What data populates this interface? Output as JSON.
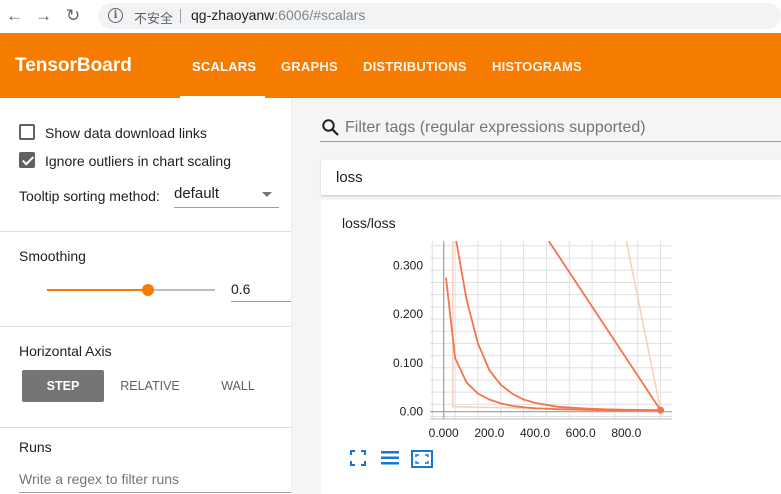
{
  "browser": {
    "back_icon": "back-arrow-icon",
    "forward_icon": "forward-arrow-icon",
    "reload_icon": "reload-icon",
    "info_glyph": "i",
    "insecure_label": "不安全",
    "url_host": "qg-zhaoyanw",
    "url_rest": ":6006/#scalars"
  },
  "header": {
    "brand": "TensorBoard",
    "tabs": [
      {
        "label": "SCALARS",
        "active": true
      },
      {
        "label": "GRAPHS"
      },
      {
        "label": "DISTRIBUTIONS"
      },
      {
        "label": "HISTOGRAMS"
      }
    ],
    "accent_color": "#f57c00"
  },
  "sidebar": {
    "show_download_label": "Show data download links",
    "show_download_checked": false,
    "ignore_outliers_label": "Ignore outliers in chart scaling",
    "ignore_outliers_checked": true,
    "tooltip_label": "Tooltip sorting method:",
    "tooltip_value": "default",
    "smoothing_title": "Smoothing",
    "smoothing_value": "0.6",
    "horizontal_axis_title": "Horizontal Axis",
    "axis_buttons": [
      {
        "label": "STEP",
        "active": true
      },
      {
        "label": "RELATIVE"
      },
      {
        "label": "WALL"
      }
    ],
    "runs_title": "Runs",
    "runs_placeholder": "Write a regex to filter runs"
  },
  "main": {
    "search_placeholder": "Filter tags (regular expressions supported)",
    "category": "loss",
    "card_title": "loss/loss",
    "toolbar_icons": [
      "fit-domain-icon",
      "toggle-log-scale-icon",
      "expand-card-icon"
    ]
  },
  "chart_data": {
    "type": "line",
    "title": "loss/loss",
    "x_tick_labels": [
      "0.000",
      "200.0",
      "400.0",
      "600.0",
      "800.0"
    ],
    "y_tick_labels": [
      "0.00",
      "0.100",
      "0.200",
      "0.300"
    ],
    "xlim": [
      -60,
      1000
    ],
    "ylim": [
      -0.015,
      0.35
    ],
    "grid": true,
    "series": [
      {
        "color": "#f4754b",
        "x": [
          10,
          50,
          100,
          150,
          200,
          250,
          300,
          350,
          400,
          500,
          600,
          700,
          800,
          950
        ],
        "y": [
          0.275,
          0.11,
          0.06,
          0.037,
          0.025,
          0.017,
          0.012,
          0.009,
          0.007,
          0.005,
          0.004,
          0.003,
          0.003,
          0.003
        ]
      },
      {
        "color": "#f4754b",
        "x": [
          55,
          100,
          150,
          200,
          250,
          300,
          350,
          400,
          500,
          600,
          700,
          800,
          950
        ],
        "y": [
          0.35,
          0.23,
          0.14,
          0.085,
          0.055,
          0.037,
          0.025,
          0.018,
          0.01,
          0.007,
          0.005,
          0.004,
          0.003
        ]
      },
      {
        "color": "#f4754b",
        "x": [
          460,
          950
        ],
        "y": [
          0.35,
          0.003
        ]
      }
    ],
    "raw_series_color": "#fbcdbb"
  }
}
